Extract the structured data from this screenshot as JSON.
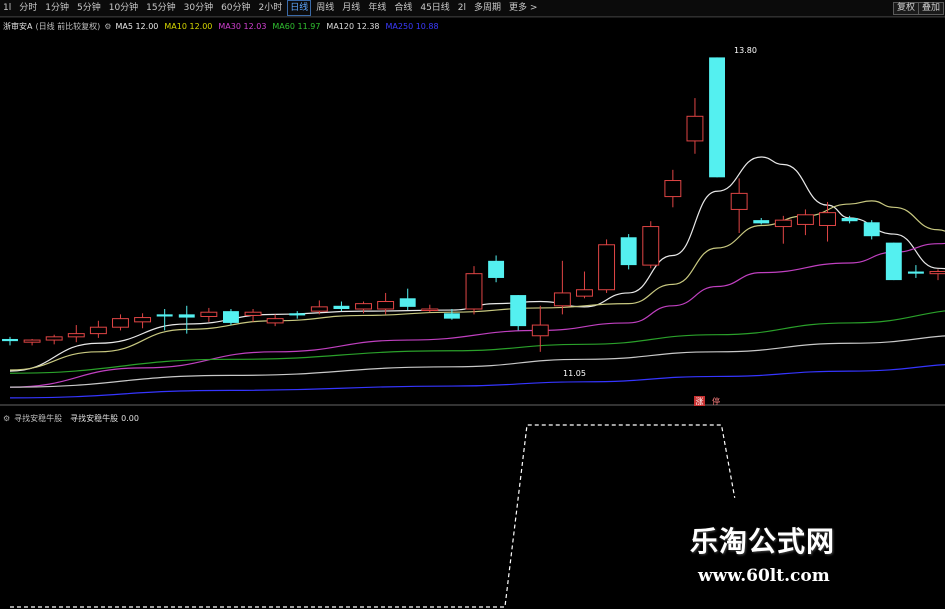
{
  "toolbar": {
    "periods": [
      "1l",
      "分时",
      "1分钟",
      "5分钟",
      "10分钟",
      "15分钟",
      "30分钟",
      "60分钟",
      "2小时",
      "日线",
      "周线",
      "月线",
      "年线",
      "合线",
      "45日线",
      "2l",
      "多周期",
      "更多 >"
    ],
    "active_period": "日线",
    "weight_button": "复权",
    "overlay_button": "叠加"
  },
  "main_legend": {
    "stock": "浙审安A",
    "mode": "(日线 前比较复权)",
    "ma_items": [
      {
        "label": "MA5",
        "value": "12.00",
        "color": "#e8e8e8"
      },
      {
        "label": "MA10",
        "value": "12.00",
        "color": "#d8d800"
      },
      {
        "label": "MA30",
        "value": "12.03",
        "color": "#d040d0"
      },
      {
        "label": "MA60",
        "value": "11.97",
        "color": "#30c030"
      },
      {
        "label": "MA120",
        "value": "12.38",
        "color": "#dddddd"
      },
      {
        "label": "MA250",
        "value": "10.88",
        "color": "#3b3bff"
      }
    ]
  },
  "annotations": {
    "high_price": "13.80",
    "low_price": "11.05",
    "bottom_badges": [
      "涨",
      "停"
    ]
  },
  "sub_legend": {
    "indicator": "寻找安稳牛股",
    "series": "寻找安稳牛股",
    "value": "0.00"
  },
  "chart_data": {
    "type": "candlestick",
    "main": {
      "ylim": [
        10.6,
        14.0
      ],
      "candles": [
        {
          "o": 11.15,
          "h": 11.19,
          "l": 11.11,
          "c": 11.17,
          "up": false
        },
        {
          "o": 11.14,
          "h": 11.17,
          "l": 11.11,
          "c": 11.16,
          "up": true
        },
        {
          "o": 11.16,
          "h": 11.21,
          "l": 11.12,
          "c": 11.19,
          "up": true
        },
        {
          "o": 11.19,
          "h": 11.3,
          "l": 11.14,
          "c": 11.22,
          "up": true
        },
        {
          "o": 11.22,
          "h": 11.34,
          "l": 11.18,
          "c": 11.28,
          "up": true
        },
        {
          "o": 11.28,
          "h": 11.4,
          "l": 11.25,
          "c": 11.36,
          "up": true
        },
        {
          "o": 11.33,
          "h": 11.41,
          "l": 11.27,
          "c": 11.37,
          "up": true
        },
        {
          "o": 11.38,
          "h": 11.45,
          "l": 11.25,
          "c": 11.4,
          "up": false
        },
        {
          "o": 11.4,
          "h": 11.48,
          "l": 11.22,
          "c": 11.37,
          "up": false
        },
        {
          "o": 11.42,
          "h": 11.46,
          "l": 11.33,
          "c": 11.38,
          "up": true
        },
        {
          "o": 11.43,
          "h": 11.45,
          "l": 11.3,
          "c": 11.32,
          "up": false
        },
        {
          "o": 11.39,
          "h": 11.45,
          "l": 11.33,
          "c": 11.42,
          "up": true
        },
        {
          "o": 11.36,
          "h": 11.4,
          "l": 11.29,
          "c": 11.32,
          "up": true
        },
        {
          "o": 11.41,
          "h": 11.43,
          "l": 11.36,
          "c": 11.39,
          "up": false
        },
        {
          "o": 11.43,
          "h": 11.53,
          "l": 11.4,
          "c": 11.47,
          "up": true
        },
        {
          "o": 11.48,
          "h": 11.52,
          "l": 11.43,
          "c": 11.45,
          "up": false
        },
        {
          "o": 11.45,
          "h": 11.52,
          "l": 11.41,
          "c": 11.5,
          "up": true
        },
        {
          "o": 11.45,
          "h": 11.6,
          "l": 11.4,
          "c": 11.52,
          "up": true
        },
        {
          "o": 11.55,
          "h": 11.64,
          "l": 11.44,
          "c": 11.47,
          "up": false
        },
        {
          "o": 11.45,
          "h": 11.49,
          "l": 11.42,
          "c": 11.45,
          "up": true
        },
        {
          "o": 11.41,
          "h": 11.45,
          "l": 11.35,
          "c": 11.36,
          "up": false
        },
        {
          "o": 11.45,
          "h": 11.85,
          "l": 11.4,
          "c": 11.78,
          "up": true
        },
        {
          "o": 11.9,
          "h": 11.95,
          "l": 11.7,
          "c": 11.74,
          "up": false
        },
        {
          "o": 11.58,
          "h": 11.58,
          "l": 11.25,
          "c": 11.29,
          "up": false
        },
        {
          "o": 11.3,
          "h": 11.48,
          "l": 11.05,
          "c": 11.2,
          "up": true
        },
        {
          "o": 11.48,
          "h": 11.9,
          "l": 11.4,
          "c": 11.6,
          "up": true
        },
        {
          "o": 11.57,
          "h": 11.8,
          "l": 11.55,
          "c": 11.63,
          "up": true
        },
        {
          "o": 11.63,
          "h": 12.1,
          "l": 11.6,
          "c": 12.05,
          "up": true
        },
        {
          "o": 12.12,
          "h": 12.15,
          "l": 11.82,
          "c": 11.86,
          "up": false
        },
        {
          "o": 11.86,
          "h": 12.27,
          "l": 11.83,
          "c": 12.22,
          "up": true
        },
        {
          "o": 12.65,
          "h": 12.75,
          "l": 12.4,
          "c": 12.5,
          "up": true
        },
        {
          "o": 13.25,
          "h": 13.42,
          "l": 12.9,
          "c": 13.02,
          "up": true
        },
        {
          "o": 13.8,
          "h": 13.8,
          "l": 12.68,
          "c": 12.68,
          "up": false
        },
        {
          "o": 12.38,
          "h": 12.67,
          "l": 12.16,
          "c": 12.53,
          "up": true
        },
        {
          "o": 12.28,
          "h": 12.3,
          "l": 12.24,
          "c": 12.25,
          "up": false
        },
        {
          "o": 12.22,
          "h": 12.32,
          "l": 12.06,
          "c": 12.28,
          "up": true
        },
        {
          "o": 12.24,
          "h": 12.38,
          "l": 12.14,
          "c": 12.33,
          "up": true
        },
        {
          "o": 12.35,
          "h": 12.45,
          "l": 12.08,
          "c": 12.23,
          "up": true
        },
        {
          "o": 12.3,
          "h": 12.32,
          "l": 12.25,
          "c": 12.27,
          "up": false
        },
        {
          "o": 12.26,
          "h": 12.28,
          "l": 12.1,
          "c": 12.13,
          "up": false
        },
        {
          "o": 12.07,
          "h": 12.07,
          "l": 11.72,
          "c": 11.72,
          "up": false
        },
        {
          "o": 11.8,
          "h": 11.86,
          "l": 11.74,
          "c": 11.78,
          "up": false
        },
        {
          "o": 11.78,
          "h": 11.82,
          "l": 11.72,
          "c": 11.8,
          "up": true
        }
      ],
      "ma": [
        {
          "name": "MA5",
          "color": "#e8e8e8",
          "points": [
            [
              0,
              10.87
            ],
            [
              4,
              11.13
            ],
            [
              8,
              11.31
            ],
            [
              12,
              11.4
            ],
            [
              16,
              11.43
            ],
            [
              20,
              11.44
            ],
            [
              22,
              11.5
            ],
            [
              24,
              11.52
            ],
            [
              26,
              11.47
            ],
            [
              28,
              11.6
            ],
            [
              30,
              11.95
            ],
            [
              32,
              12.55
            ],
            [
              34,
              12.87
            ],
            [
              35,
              12.8
            ],
            [
              37,
              12.42
            ],
            [
              38,
              12.3
            ],
            [
              40,
              12.15
            ],
            [
              42,
              11.83
            ],
            [
              44,
              11.76
            ]
          ]
        },
        {
          "name": "MA10",
          "color": "#c8c880",
          "points": [
            [
              0,
              10.88
            ],
            [
              4,
              11.05
            ],
            [
              8,
              11.26
            ],
            [
              12,
              11.34
            ],
            [
              16,
              11.39
            ],
            [
              20,
              11.42
            ],
            [
              24,
              11.46
            ],
            [
              28,
              11.5
            ],
            [
              30,
              11.68
            ],
            [
              32,
              12.02
            ],
            [
              34,
              12.23
            ],
            [
              36,
              12.32
            ],
            [
              38,
              12.43
            ],
            [
              39,
              12.46
            ],
            [
              40,
              12.4
            ],
            [
              42,
              12.19
            ],
            [
              44,
              11.88
            ]
          ]
        },
        {
          "name": "MA30",
          "color": "#c040c0",
          "points": [
            [
              0,
              10.72
            ],
            [
              6,
              10.9
            ],
            [
              12,
              11.05
            ],
            [
              18,
              11.16
            ],
            [
              24,
              11.25
            ],
            [
              28,
              11.32
            ],
            [
              30,
              11.48
            ],
            [
              32,
              11.66
            ],
            [
              34,
              11.79
            ],
            [
              38,
              11.88
            ],
            [
              40,
              11.98
            ],
            [
              42,
              12.06
            ],
            [
              44,
              12.12
            ]
          ]
        },
        {
          "name": "MA60",
          "color": "#2aa02a",
          "points": [
            [
              0,
              10.85
            ],
            [
              10,
              10.98
            ],
            [
              20,
              11.06
            ],
            [
              26,
              11.12
            ],
            [
              32,
              11.21
            ],
            [
              38,
              11.32
            ],
            [
              44,
              11.45
            ]
          ]
        },
        {
          "name": "MA120",
          "color": "#c8c8c8",
          "points": [
            [
              0,
              10.72
            ],
            [
              10,
              10.83
            ],
            [
              20,
              10.91
            ],
            [
              26,
              10.98
            ],
            [
              32,
              11.05
            ],
            [
              38,
              11.13
            ],
            [
              44,
              11.21
            ]
          ]
        },
        {
          "name": "MA250",
          "color": "#3535ff",
          "points": [
            [
              0,
              10.62
            ],
            [
              10,
              10.69
            ],
            [
              20,
              10.73
            ],
            [
              26,
              10.77
            ],
            [
              32,
              10.82
            ],
            [
              38,
              10.87
            ],
            [
              44,
              10.94
            ]
          ]
        }
      ]
    },
    "sub": {
      "ylim": [
        0,
        1
      ],
      "points": [
        [
          0,
          0
        ],
        [
          22.4,
          0
        ],
        [
          23.4,
          1
        ],
        [
          32.2,
          1
        ],
        [
          32.8,
          0.6
        ]
      ]
    }
  },
  "watermark": {
    "title": "乐淘公式网",
    "url": "www.60lt.com"
  }
}
